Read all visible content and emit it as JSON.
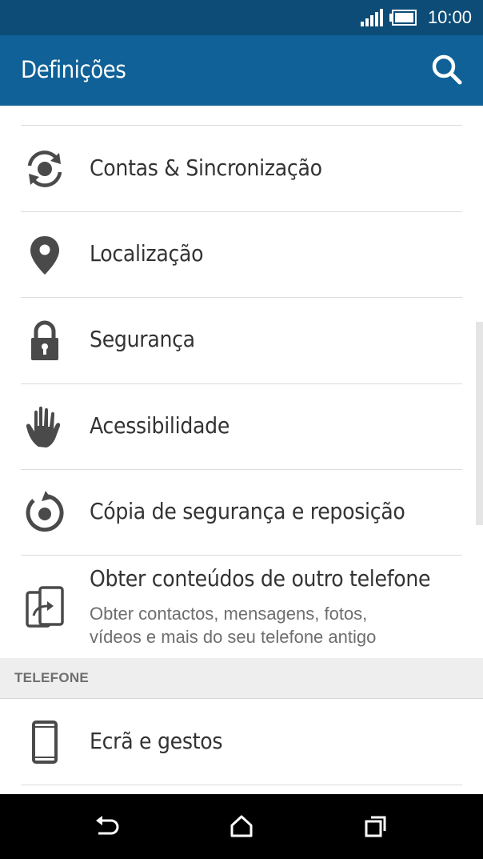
{
  "status": {
    "time": "10:00"
  },
  "app_bar": {
    "title": "Definições"
  },
  "items": [
    {
      "label": "Contas & Sincronização",
      "icon": "sync-icon"
    },
    {
      "label": "Localização",
      "icon": "location-pin-icon"
    },
    {
      "label": "Segurança",
      "icon": "lock-icon"
    },
    {
      "label": "Acessibilidade",
      "icon": "hand-icon"
    },
    {
      "label": "Cópia de segurança e reposição",
      "icon": "backup-restore-icon"
    },
    {
      "label": "Obter conteúdos de outro telefone",
      "subtitle_line1": "Obter contactos, mensagens, fotos,",
      "subtitle_line2": "vídeos e mais do seu telefone antigo",
      "icon": "transfer-phone-icon"
    }
  ],
  "section": {
    "label": "TELEFONE"
  },
  "phone_items": [
    {
      "label": "Ecrã e gestos",
      "icon": "phone-icon"
    }
  ],
  "colors": {
    "status_bar": "#0c4c77",
    "app_bar": "#0f6197",
    "icon": "#4a4a4a"
  }
}
